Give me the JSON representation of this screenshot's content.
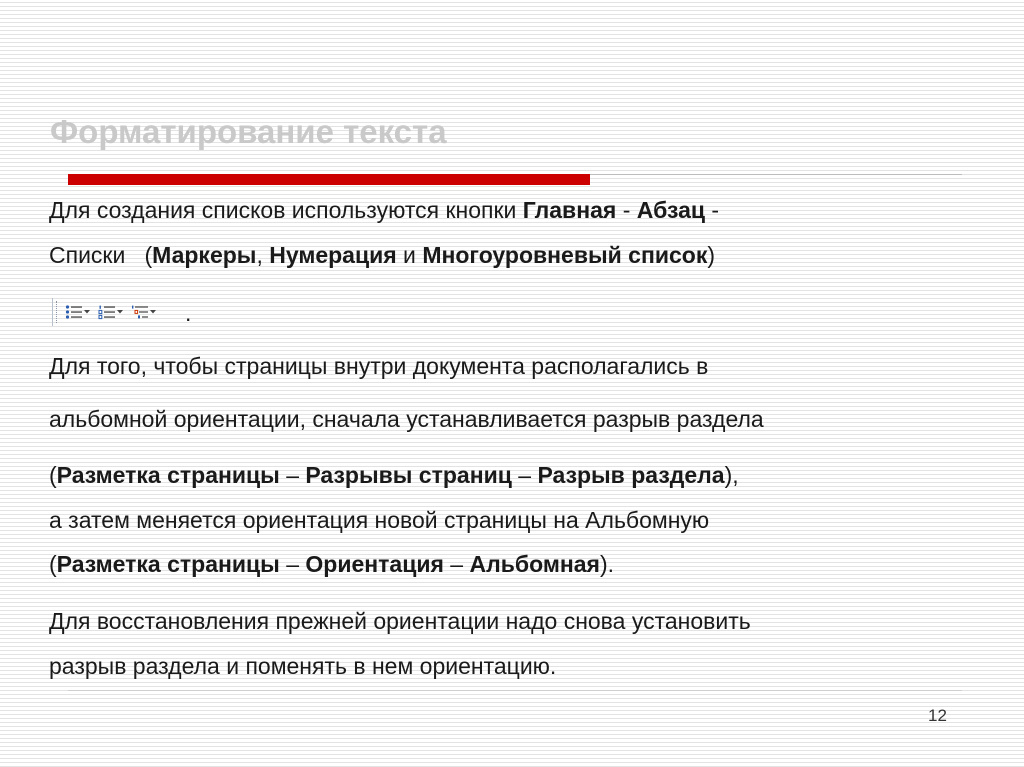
{
  "slide": {
    "title": "Форматирование текста",
    "page_number": "12"
  },
  "para1": {
    "line1": {
      "t1": "Для создания списков используются кнопки ",
      "b1": "Главная",
      "t2": " - ",
      "b2": "Абзац",
      "t3": " -"
    },
    "line2": {
      "t1": "Списки   (",
      "b1": "Маркеры",
      "t2": ", ",
      "b2": "Нумерация",
      "t3": " и ",
      "b3": "Многоуровневый список",
      "t4": ")"
    },
    "toolbar": {
      "icons": [
        "bullets-icon",
        "numbering-icon",
        "multilevel-list-icon"
      ],
      "trailing_period": "."
    }
  },
  "para2": {
    "line1": "Для того, чтобы страницы внутри документа располагались в",
    "line2": "альбомной ориентации, сначала устанавливается разрыв раздела",
    "line3": {
      "t1": "(",
      "b1": "Разметка страницы",
      "t2": " – ",
      "b2": "Разрывы страниц",
      "t3": " – ",
      "b3": "Разрыв раздела",
      "t4": "),"
    },
    "line4": "а затем меняется ориентация новой страницы на Альбомную",
    "line5": {
      "t1": "(",
      "b1": "Разметка страницы",
      "t2": " – ",
      "b2": "Ориентация",
      "t3": " – ",
      "b3": "Альбомная",
      "t4": ")."
    }
  },
  "para3": {
    "line1": "Для восстановления прежней ориентации надо снова установить",
    "line2": "разрыв раздела и поменять в нем ориентацию."
  },
  "colors": {
    "accent_red": "#cc0000",
    "title_gray": "#c9c9c9",
    "text": "#1a1a1a"
  }
}
